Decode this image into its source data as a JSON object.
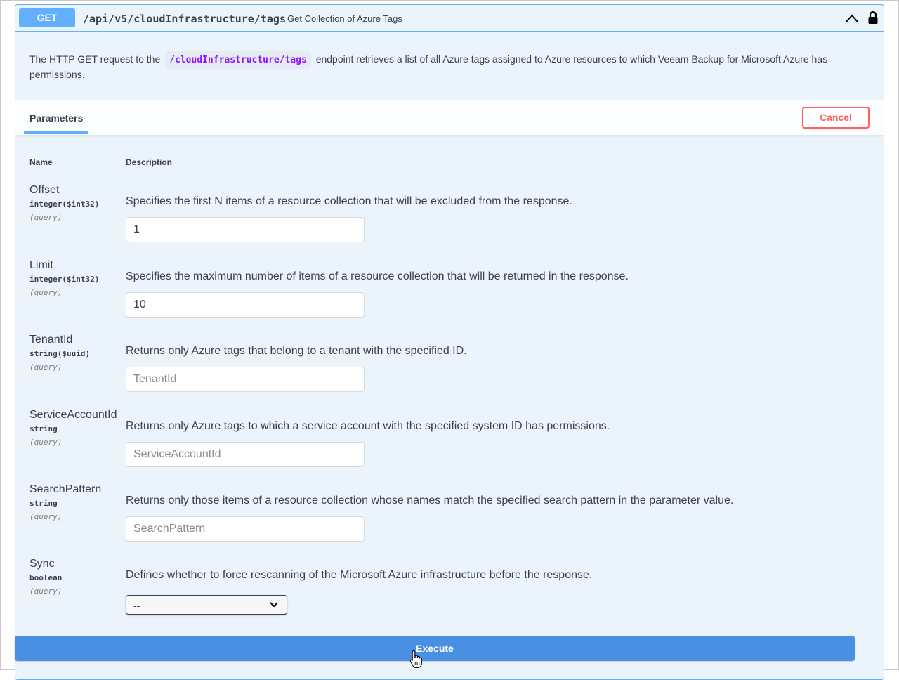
{
  "operation": {
    "method": "GET",
    "path": "/api/v5/cloudInfrastructure/tags",
    "summary": "Get Collection of Azure Tags",
    "description_before": "The HTTP GET request to the",
    "description_code": "/cloudInfrastructure/tags",
    "description_after": "endpoint retrieves a list of all Azure tags assigned to Azure resources to which Veeam Backup for Microsoft Azure has permissions."
  },
  "icons": {
    "collapse": "chevron-up-icon",
    "lock": "lock-icon",
    "cursor": "hand-pointer-cursor-icon"
  },
  "colors": {
    "get_accent": "#61affe",
    "cancel": "#ff6060",
    "execute": "#4990e2"
  },
  "tabs": {
    "parameters": "Parameters"
  },
  "buttons": {
    "cancel": "Cancel",
    "execute": "Execute"
  },
  "table": {
    "col_name": "Name",
    "col_description": "Description"
  },
  "params": [
    {
      "name": "Offset",
      "type": "integer($int32)",
      "in": "(query)",
      "description": "Specifies the first N items of a resource collection that will be excluded from the response.",
      "value": "1",
      "placeholder": ""
    },
    {
      "name": "Limit",
      "type": "integer($int32)",
      "in": "(query)",
      "description": "Specifies the maximum number of items of a resource collection that will be returned in the response.",
      "value": "10",
      "placeholder": ""
    },
    {
      "name": "TenantId",
      "type": "string($uuid)",
      "in": "(query)",
      "description": "Returns only Azure tags that belong to a tenant with the specified ID.",
      "value": "",
      "placeholder": "TenantId"
    },
    {
      "name": "ServiceAccountId",
      "type": "string",
      "in": "(query)",
      "description": "Returns only Azure tags to which a service account with the specified system ID has permissions.",
      "value": "",
      "placeholder": "ServiceAccountId"
    },
    {
      "name": "SearchPattern",
      "type": "string",
      "in": "(query)",
      "description": "Returns only those items of a resource collection whose names match the specified search pattern in the parameter value.",
      "value": "",
      "placeholder": "SearchPattern"
    },
    {
      "name": "Sync",
      "type": "boolean",
      "in": "(query)",
      "description": "Defines whether to force rescanning of the Microsoft Azure infrastructure before the response.",
      "selected": "--"
    }
  ]
}
